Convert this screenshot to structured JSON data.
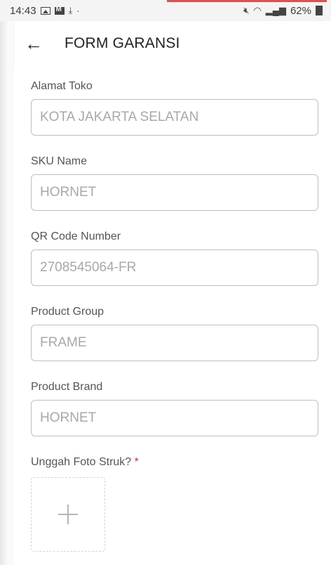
{
  "status_bar": {
    "time": "14:43",
    "dot": "·",
    "signal_text": "♒ ∷ .∥",
    "battery_percent": "62%"
  },
  "app_bar": {
    "back_icon": "←",
    "title": "FORM GARANSI"
  },
  "form": {
    "fields": [
      {
        "label": "Alamat Toko",
        "value": "KOTA JAKARTA SELATAN"
      },
      {
        "label": "SKU Name",
        "value": "HORNET"
      },
      {
        "label": "QR Code Number",
        "value": "2708545064-FR"
      },
      {
        "label": "Product Group",
        "value": "FRAME"
      },
      {
        "label": "Product Brand",
        "value": "HORNET"
      }
    ],
    "upload": {
      "label": "Unggah Foto Struk?",
      "required_mark": "*"
    }
  },
  "colors": {
    "required": "#d32f2f",
    "accent_strip": "#d9534f"
  }
}
